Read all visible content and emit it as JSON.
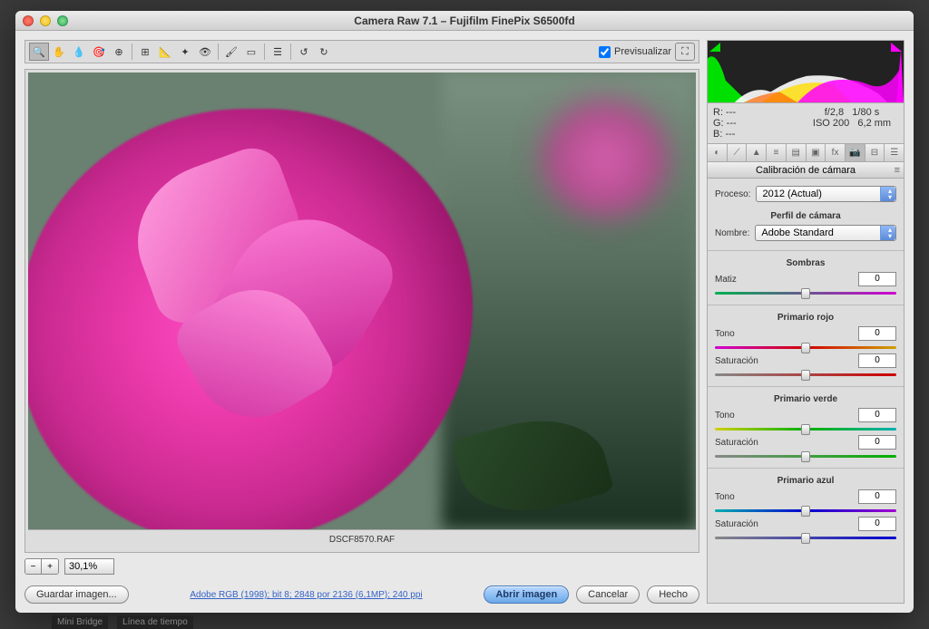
{
  "window": {
    "title": "Camera Raw 7.1 – Fujifilm FinePix S6500fd"
  },
  "toolbar": {
    "preview_label": "Previsualizar"
  },
  "zoom": {
    "value": "30,1%",
    "minus": "−",
    "plus": "+"
  },
  "file": {
    "name": "DSCF8570.RAF"
  },
  "exif": {
    "r": "R:   ---",
    "g": "G:   ---",
    "b": "B:   ---",
    "aperture": "f/2,8",
    "shutter": "1/80 s",
    "iso": "ISO 200",
    "focal": "6,2 mm"
  },
  "panel": {
    "title": "Calibración de cámara",
    "process_label": "Proceso:",
    "process_value": "2012 (Actual)",
    "profile_header": "Perfil de cámara",
    "name_label": "Nombre:",
    "name_value": "Adobe Standard",
    "sections": {
      "shadows": {
        "title": "Sombras",
        "tint_label": "Matiz",
        "tint_val": "0"
      },
      "red": {
        "title": "Primario rojo",
        "hue_label": "Tono",
        "hue_val": "0",
        "sat_label": "Saturación",
        "sat_val": "0"
      },
      "green": {
        "title": "Primario verde",
        "hue_label": "Tono",
        "hue_val": "0",
        "sat_label": "Saturación",
        "sat_val": "0"
      },
      "blue": {
        "title": "Primario azul",
        "hue_label": "Tono",
        "hue_val": "0",
        "sat_label": "Saturación",
        "sat_val": "0"
      }
    }
  },
  "buttons": {
    "save": "Guardar imagen...",
    "open": "Abrir imagen",
    "cancel": "Cancelar",
    "done": "Hecho"
  },
  "link": "Adobe RGB (1998); bit 8; 2848 por 2136 (6,1MP); 240 ppi",
  "footer": {
    "mini_bridge": "Mini Bridge",
    "timeline": "Línea de tiempo"
  },
  "gradients": {
    "shadows_tint": "linear-gradient(to right, #00b050, #d000d0)",
    "red_hue": "linear-gradient(to right, #d000d0, #d00000, #d0a000)",
    "red_sat": "linear-gradient(to right, #888, #d00000)",
    "green_hue": "linear-gradient(to right, #d0d000, #00b000, #00b0b0)",
    "green_sat": "linear-gradient(to right, #888, #00b000)",
    "blue_hue": "linear-gradient(to right, #00b0b0, #0000d0, #a000d0)",
    "blue_sat": "linear-gradient(to right, #888, #0000d0)"
  }
}
